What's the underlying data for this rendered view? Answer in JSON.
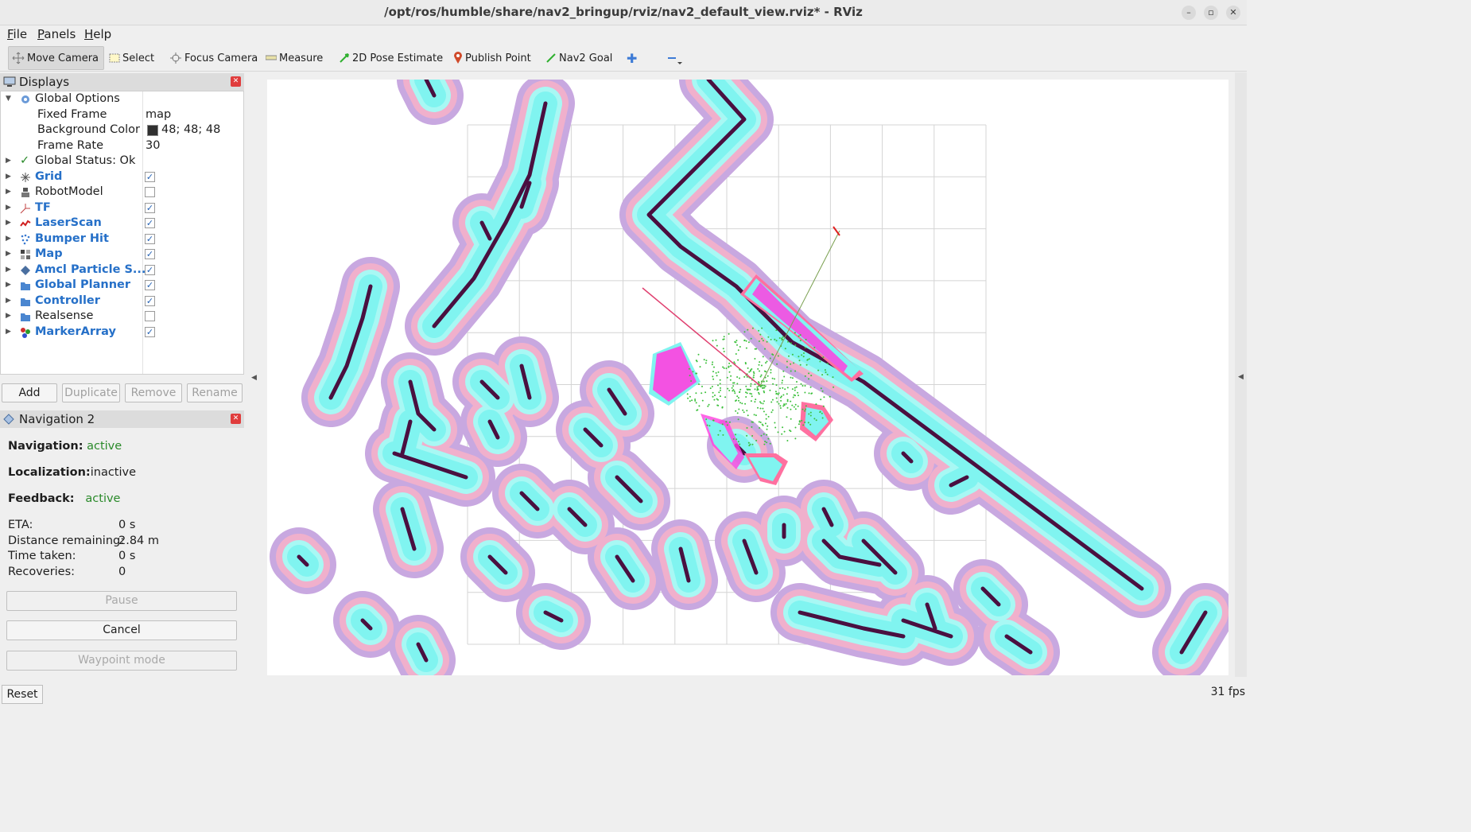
{
  "window": {
    "title": "/opt/ros/humble/share/nav2_bringup/rviz/nav2_default_view.rviz* - RViz"
  },
  "menu": [
    {
      "label": "File",
      "key": "F",
      "rest": "ile"
    },
    {
      "label": "Panels",
      "key": "P",
      "rest": "anels"
    },
    {
      "label": "Help",
      "key": "H",
      "rest": "elp"
    }
  ],
  "toolbar": {
    "move_camera": "Move Camera",
    "select": "Select",
    "focus_camera": "Focus Camera",
    "measure": "Measure",
    "pose_estimate": "2D Pose Estimate",
    "publish_point": "Publish Point",
    "nav2_goal": "Nav2 Goal"
  },
  "displays": {
    "title": "Displays",
    "global_options": "Global Options",
    "fixed_frame_label": "Fixed Frame",
    "fixed_frame_value": "map",
    "bg_color_label": "Background Color",
    "bg_color_value": "48; 48; 48",
    "frame_rate_label": "Frame Rate",
    "frame_rate_value": "30",
    "global_status": "Global Status: Ok",
    "items": [
      {
        "label": "Grid",
        "checked": true,
        "icon": "grid-icon"
      },
      {
        "label": "RobotModel",
        "checked": false,
        "icon": "robot-icon"
      },
      {
        "label": "TF",
        "checked": true,
        "icon": "tf-icon"
      },
      {
        "label": "LaserScan",
        "checked": true,
        "icon": "laserscan-icon"
      },
      {
        "label": "Bumper Hit",
        "checked": true,
        "icon": "bumper-icon"
      },
      {
        "label": "Map",
        "checked": true,
        "icon": "map-icon"
      },
      {
        "label": "Amcl Particle S...",
        "checked": true,
        "icon": "particle-icon"
      },
      {
        "label": "Global Planner",
        "checked": true,
        "icon": "folder-icon"
      },
      {
        "label": "Controller",
        "checked": true,
        "icon": "folder-icon"
      },
      {
        "label": "Realsense",
        "checked": false,
        "icon": "folder-icon"
      },
      {
        "label": "MarkerArray",
        "checked": true,
        "icon": "marker-icon"
      }
    ],
    "buttons": {
      "add": "Add",
      "duplicate": "Duplicate",
      "remove": "Remove",
      "rename": "Rename"
    }
  },
  "navigation": {
    "title": "Navigation 2",
    "nav_label": "Navigation:",
    "nav_value": "active",
    "loc_label": "Localization:",
    "loc_value": "inactive",
    "fb_label": "Feedback:",
    "fb_value": "active",
    "eta_label": "ETA:",
    "eta_value": "0 s",
    "dist_label": "Distance remaining:",
    "dist_value": "2.84 m",
    "time_label": "Time taken:",
    "time_value": "0 s",
    "rec_label": "Recoveries:",
    "rec_value": "0",
    "pause": "Pause",
    "cancel": "Cancel",
    "waypoint": "Waypoint mode"
  },
  "bottom": {
    "reset": "Reset",
    "fps": "31 fps"
  },
  "colors": {
    "accent": "#2670c8",
    "active": "#2a8a2a",
    "inflation_outer": "#c8a8e0",
    "inflation_mid": "#f0b0cc",
    "inflation_inner": "#80f4f0",
    "obstacle": "#4a1040",
    "costmap_lethal": "#ff40e0"
  }
}
